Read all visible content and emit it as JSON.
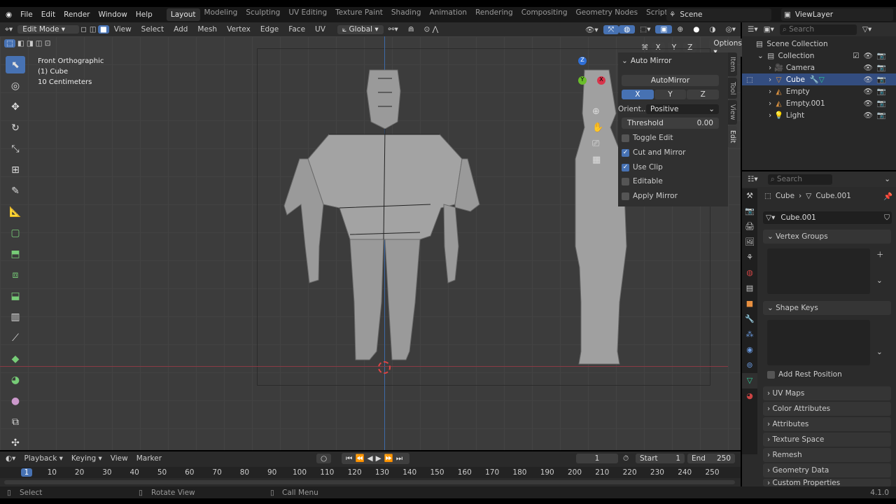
{
  "menu": {
    "items": [
      "File",
      "Edit",
      "Render",
      "Window",
      "Help"
    ]
  },
  "workspaces": [
    "Layout",
    "Modeling",
    "Sculpting",
    "UV Editing",
    "Texture Paint",
    "Shading",
    "Animation",
    "Rendering",
    "Compositing",
    "Geometry Nodes",
    "Scripting",
    "+"
  ],
  "scene": "Scene",
  "view_layer": "ViewLayer",
  "header": {
    "mode": "Edit Mode",
    "menus": [
      "View",
      "Select",
      "Add",
      "Mesh",
      "Vertex",
      "Edge",
      "Face",
      "UV"
    ],
    "orientation": "Global",
    "axes": [
      "X",
      "Y",
      "Z"
    ],
    "options": "Options"
  },
  "viewport": {
    "view_name": "Front Orthographic",
    "object": "(1) Cube",
    "scale": "10 Centimeters",
    "gizmo": {
      "x": "X",
      "y": "Y",
      "z": "Z"
    }
  },
  "auto_mirror": {
    "title": "Auto Mirror",
    "button": "AutoMirror",
    "axes": [
      "X",
      "Y",
      "Z"
    ],
    "active_axis": "X",
    "orient_label": "Orient...",
    "orient_value": "Positive",
    "threshold_label": "Threshold",
    "threshold_value": "0.00",
    "toggles": [
      {
        "label": "Toggle Edit",
        "checked": false
      },
      {
        "label": "Cut and Mirror",
        "checked": true
      },
      {
        "label": "Use Clip",
        "checked": true
      },
      {
        "label": "Editable",
        "checked": false
      },
      {
        "label": "Apply Mirror",
        "checked": false
      }
    ]
  },
  "n_tabs": [
    "Item",
    "Tool",
    "View",
    "Edit"
  ],
  "outliner": {
    "search_placeholder": "Search",
    "items": [
      {
        "label": "Scene Collection"
      },
      {
        "label": "Collection"
      },
      {
        "label": "Camera"
      },
      {
        "label": "Cube"
      },
      {
        "label": "Empty"
      },
      {
        "label": "Empty.001"
      },
      {
        "label": "Light"
      }
    ]
  },
  "properties": {
    "search_placeholder": "Search",
    "breadcrumb": [
      "Cube",
      "Cube.001"
    ],
    "mesh_name": "Cube.001",
    "panels": {
      "vertex_groups": "Vertex Groups",
      "shape_keys": "Shape Keys",
      "add_rest": "Add Rest Position",
      "collapsed": [
        "UV Maps",
        "Color Attributes",
        "Attributes",
        "Texture Space",
        "Remesh",
        "Geometry Data",
        "Custom Properties"
      ]
    }
  },
  "timeline": {
    "menus": [
      "Playback",
      "Keying",
      "View",
      "Marker"
    ],
    "current_frame": "1",
    "start_label": "Start",
    "start": "1",
    "end_label": "End",
    "end": "250",
    "ticks": [
      "1",
      "10",
      "20",
      "30",
      "40",
      "50",
      "60",
      "70",
      "80",
      "90",
      "100",
      "110",
      "120",
      "130",
      "140",
      "150",
      "160",
      "170",
      "180",
      "190",
      "200",
      "210",
      "220",
      "230",
      "240",
      "250"
    ]
  },
  "status": {
    "select": "Select",
    "rotate": "Rotate View",
    "call_menu": "Call Menu",
    "version": "4.1.0"
  },
  "colors": {
    "accent": "#4772b3",
    "selected_row": "#334d80"
  }
}
